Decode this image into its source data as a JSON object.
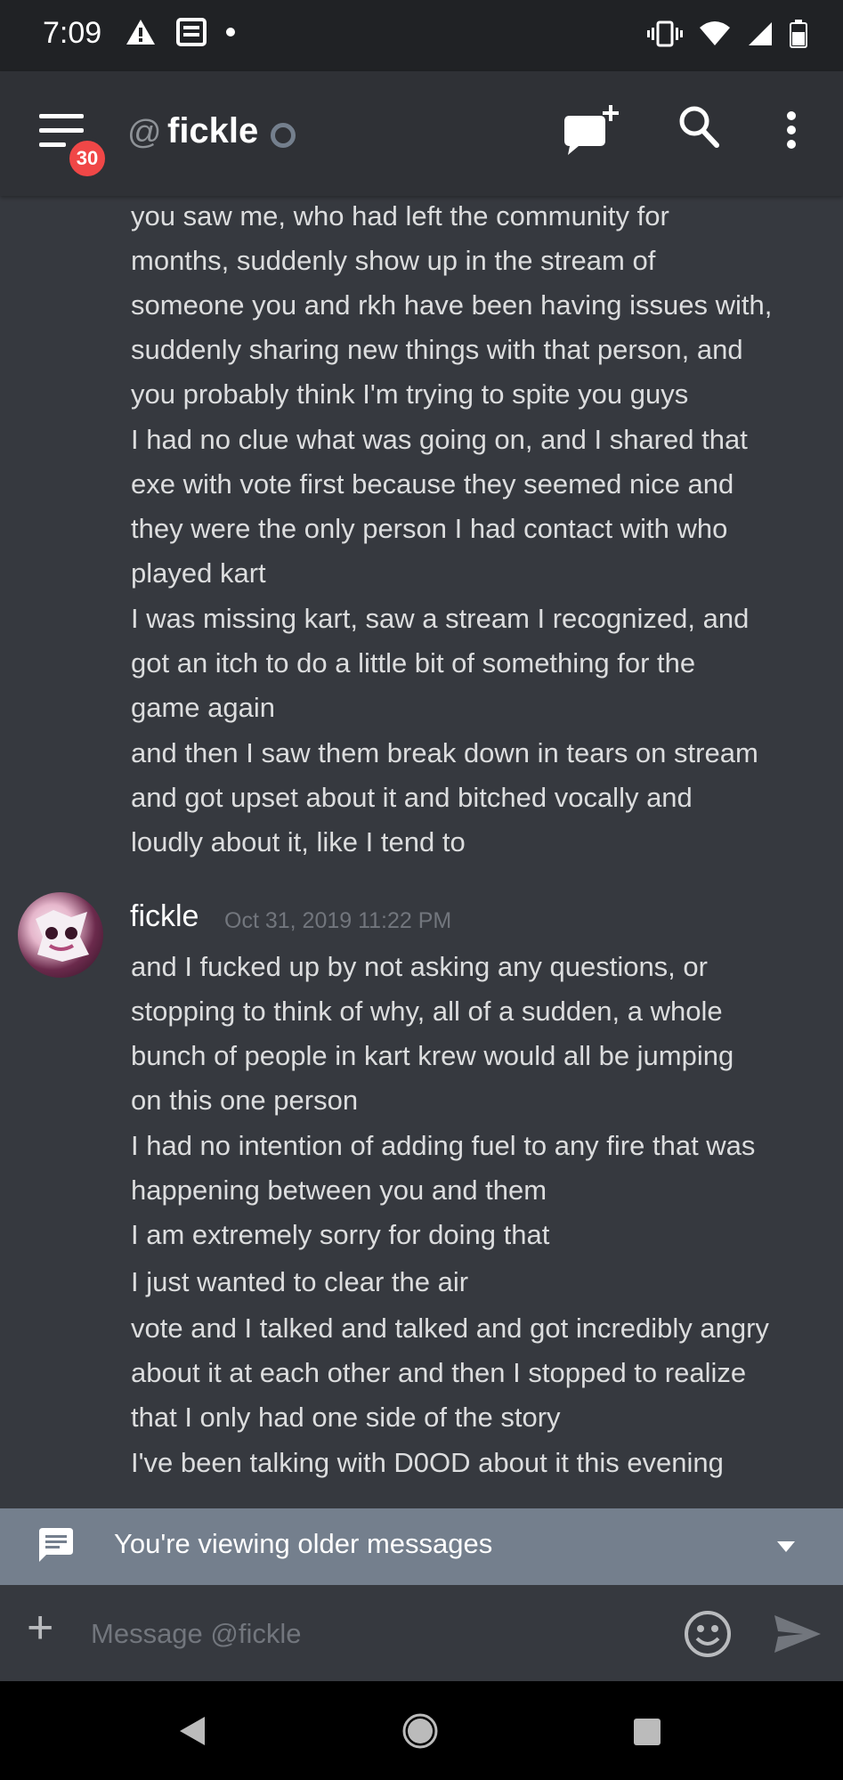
{
  "status_bar": {
    "time": "7:09"
  },
  "header": {
    "at_symbol": "@",
    "channel_name": "fickle",
    "unread_badge": "30"
  },
  "messages": {
    "continuation_lines": [
      "you saw me, who had left the community for",
      "months, suddenly show up in the stream of",
      "someone you and rkh have been having issues with,",
      "suddenly sharing new things with that person, and",
      "you probably think I'm trying to spite you guys",
      "I had no clue what was going on, and I shared that",
      "exe with vote first because they seemed nice and",
      "they were the only person I had contact with who",
      "played kart",
      "I was missing kart, saw a stream I recognized, and",
      "got an itch to do a little bit of something for the",
      "game again",
      "and then I saw them break down in tears on stream",
      "and got upset about it and bitched vocally and",
      "loudly about it, like I tend to"
    ],
    "group": {
      "author": "fickle",
      "timestamp": "Oct 31, 2019 11:22 PM",
      "lines": [
        "and I fucked up by not asking any questions, or",
        "stopping to think of why, all of a sudden, a whole",
        "bunch of people in kart krew would all be jumping",
        "on this one person",
        "I had no intention of adding fuel to any fire that was",
        "happening between you and them",
        "I am extremely sorry for doing that",
        "I just wanted to clear the air",
        "vote and I talked and talked and got incredibly angry",
        "about it at each other and then I stopped to realize",
        "that I only had one side of the story",
        "I've been talking with D0OD about it this evening"
      ]
    }
  },
  "older_messages_bar": {
    "label": "You're viewing older messages"
  },
  "composer": {
    "placeholder": "Message @fickle"
  },
  "colors": {
    "background": "#36393f",
    "header": "#2f3136",
    "older_bar": "#747f8d",
    "badge": "#f04747"
  }
}
